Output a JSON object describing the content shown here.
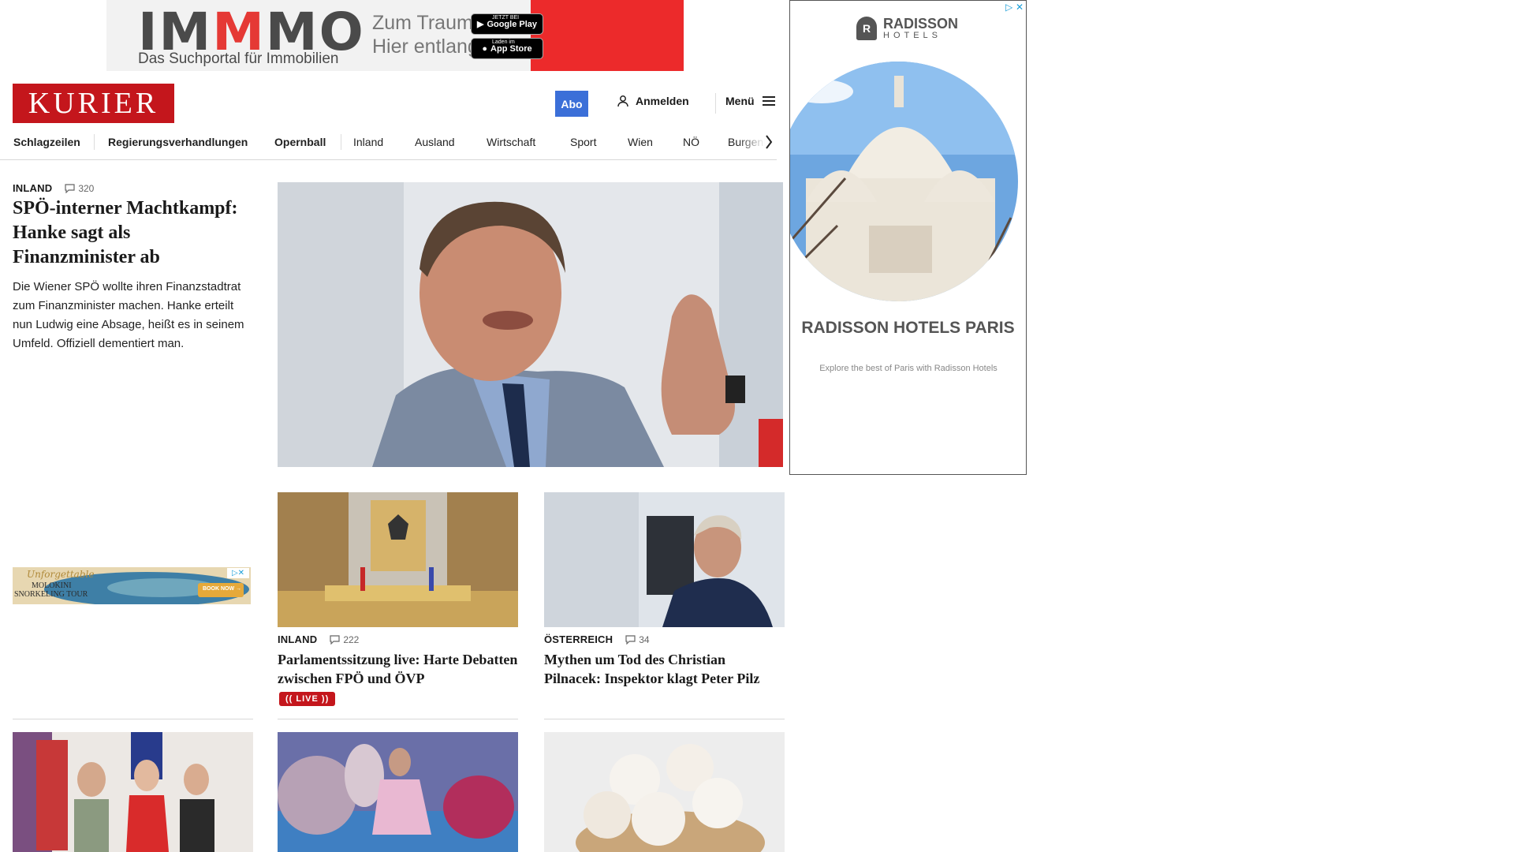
{
  "top_ad": {
    "brand_a": "IM",
    "brand_m": "M",
    "brand_b": "MO",
    "subline": "Das Suchportal für Immobilien",
    "tagline": "Zum Traumhaus?\nHier entlang.",
    "google_play_small": "JETZT BEI",
    "google_play": "Google Play",
    "app_store_small": "Laden im",
    "app_store": "App Store"
  },
  "header": {
    "logo": "KURIER",
    "abo": "Abo",
    "login": "Anmelden",
    "menu": "Menü"
  },
  "nav": {
    "items": [
      "Schlagzeilen",
      "Regierungsverhandlungen",
      "Opernball",
      "Inland",
      "Ausland",
      "Wirtschaft",
      "Sport",
      "Wien",
      "NÖ",
      "Burgenland"
    ]
  },
  "lead": {
    "kicker": "INLAND",
    "comments": "320",
    "title": "SPÖ-interner Machtkampf: Hanke sagt als Finanzminister ab",
    "teaser": "Die Wiener SPÖ wollte ihren Finanzstadtrat zum Finanzminister machen. Hanke erteilt nun Ludwig eine Absage, heißt es in seinem Umfeld. Offiziell dementiert man."
  },
  "cards": [
    {
      "kicker": "INLAND",
      "comments": "222",
      "title": "Parlamentssitzung live: Harte Debatten zwischen FPÖ und ÖVP",
      "badge": "LIVE"
    },
    {
      "kicker": "ÖSTERREICH",
      "comments": "34",
      "title": "Mythen um Tod des Christian Pilnacek: Inspektor klagt Peter Pilz"
    }
  ],
  "mini_ad": {
    "script": "Unforgettable",
    "line1": "MOLOKINI",
    "line2": "SNORKELING TOUR",
    "cta": "BOOK NOW →"
  },
  "side_ad": {
    "brand": "RADISSON",
    "brand_sub": "HOTELS",
    "title": "RADISSON HOTELS PARIS",
    "text": "Explore the best of Paris with Radisson Hotels"
  },
  "colors": {
    "brand_red": "#c4161c",
    "abo_blue": "#3b6fd8",
    "immo_red": "#ec2a2b"
  }
}
